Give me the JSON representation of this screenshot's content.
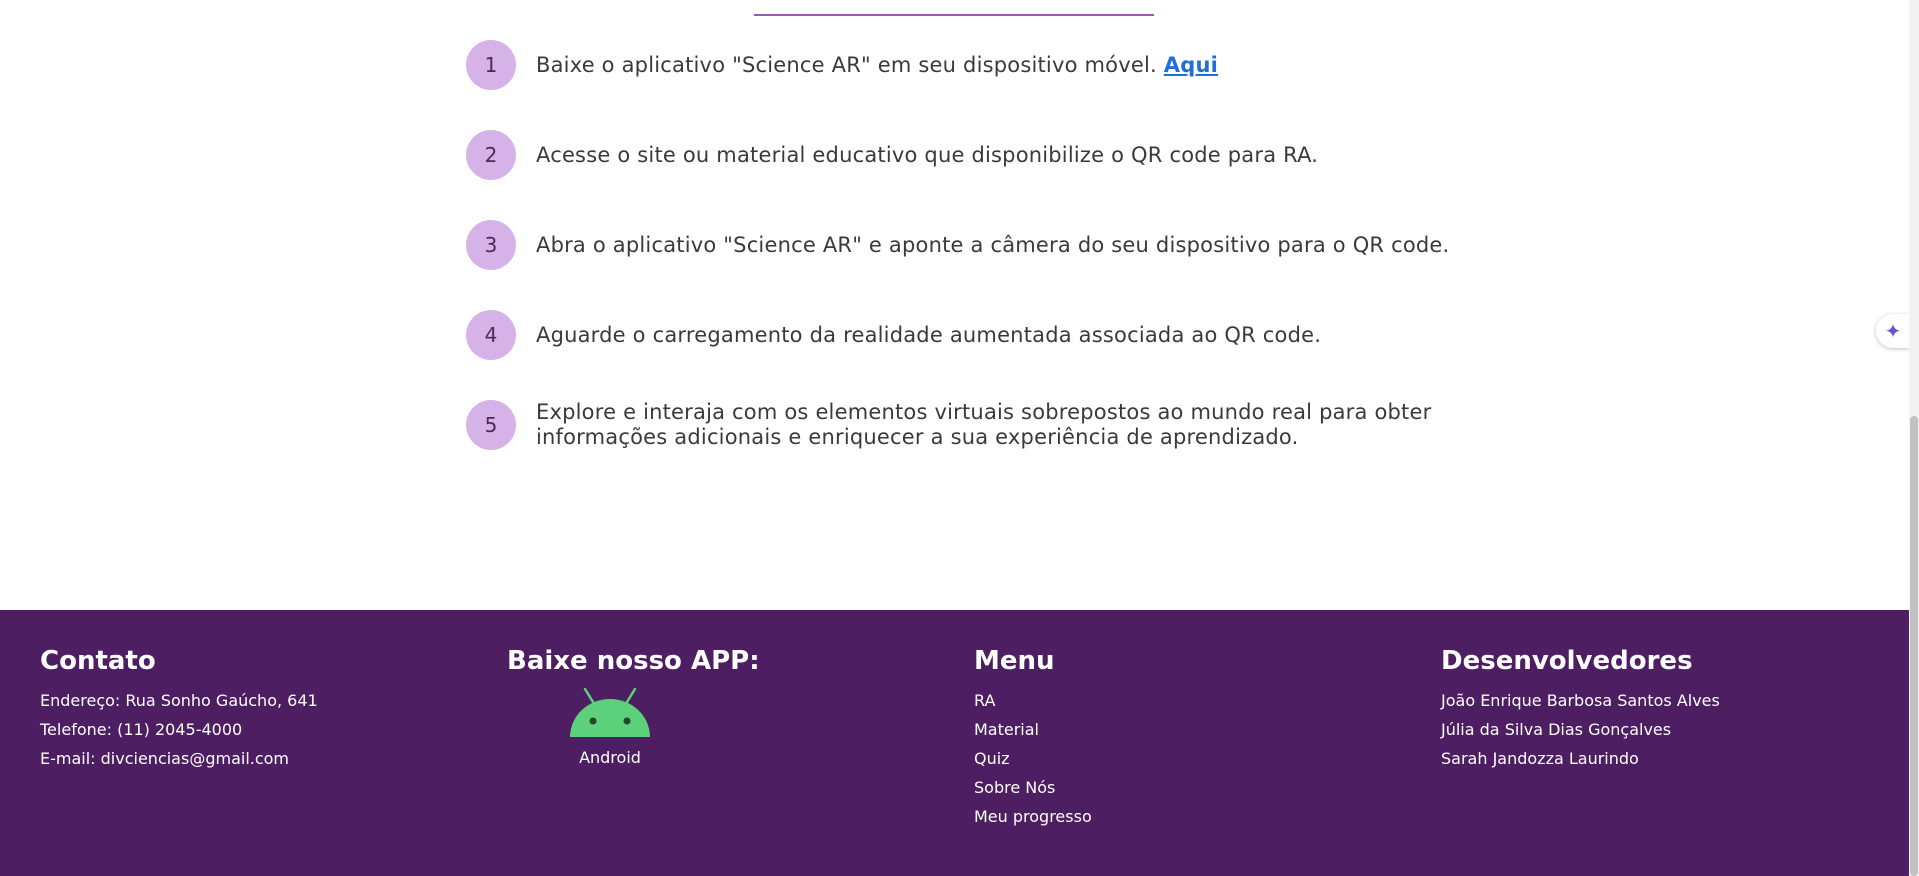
{
  "steps": [
    {
      "number": "1",
      "text": "Baixe o aplicativo \"Science AR\" em seu dispositivo móvel.",
      "link_label": "Aqui"
    },
    {
      "number": "2",
      "text": "Acesse o site ou material educativo que disponibilize o QR code para RA."
    },
    {
      "number": "3",
      "text": "Abra o aplicativo \"Science AR\" e aponte a câmera do seu dispositivo para o QR code."
    },
    {
      "number": "4",
      "text": "Aguarde o carregamento da realidade aumentada associada ao QR code."
    },
    {
      "number": "5",
      "text": "Explore e interaja com os elementos virtuais sobrepostos ao mundo real para obter informações adicionais e enriquecer a sua experiência de aprendizado."
    }
  ],
  "assistant": {
    "icon": "sparkle-icon"
  },
  "footer": {
    "contact": {
      "title": "Contato",
      "address": "Endereço: Rua Sonho Gaúcho, 641",
      "phone": "Telefone: (11) 2045-4000",
      "email": "E-mail: divciencias@gmail.com"
    },
    "app": {
      "title": "Baixe nosso APP:",
      "icon": "android-icon",
      "label": "Android"
    },
    "menu": {
      "title": "Menu",
      "items": [
        "RA",
        "Material",
        "Quiz",
        "Sobre Nós",
        "Meu progresso"
      ]
    },
    "developers": {
      "title": "Desenvolvedores",
      "names": [
        "João Enrique Barbosa Santos Alves",
        "Júlia da Silva Dias Gonçalves",
        "Sarah Jandozza Laurindo"
      ]
    }
  },
  "colors": {
    "footer_bg": "#4e1e62",
    "step_circle": "#d5b3e8",
    "link": "#1f6fd6",
    "accent_rule": "#9b59b6"
  }
}
